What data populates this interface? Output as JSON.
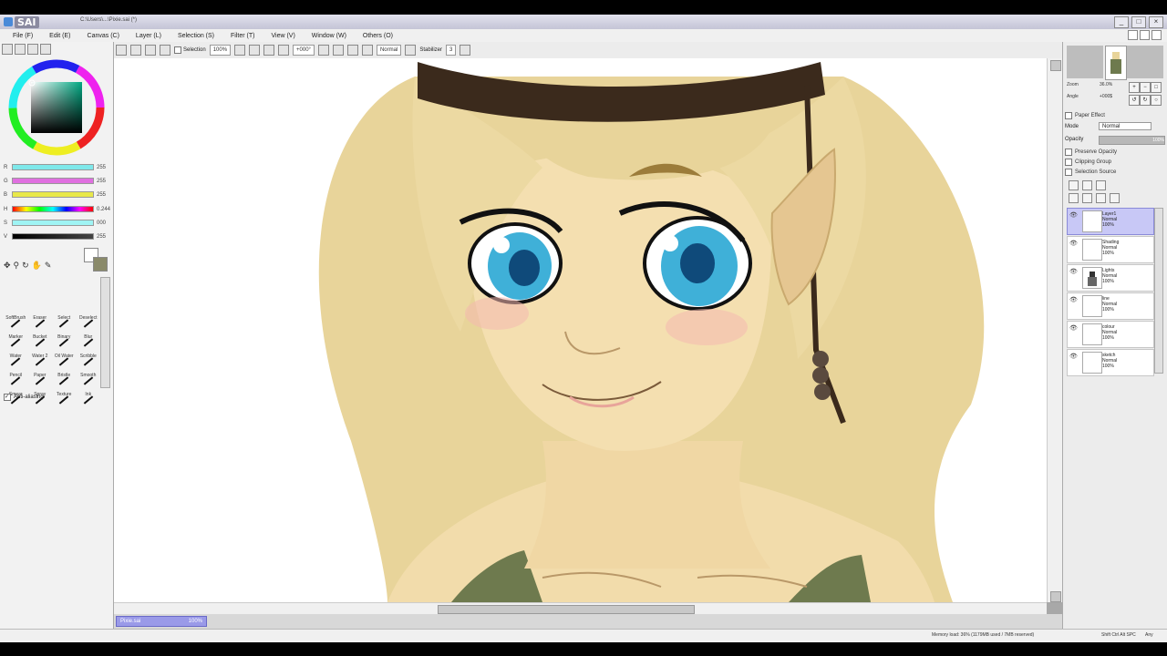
{
  "titlebar": {
    "app_name": "SAI",
    "path": "C:\\Users\\...\\Pixie.sai (*)"
  },
  "window_buttons": [
    "_",
    "□",
    "×"
  ],
  "menu": [
    "File (F)",
    "Edit (E)",
    "Canvas (C)",
    "Layer (L)",
    "Selection (S)",
    "Filter (T)",
    "View (V)",
    "Window (W)",
    "Others (O)"
  ],
  "toolbar": {
    "selection_label": "Selection",
    "zoom": "100%",
    "rotation": "+000°",
    "blend_mode": "Normal",
    "stabilizer_label": "Stabilizer",
    "stabilizer_value": "3"
  },
  "color_sliders": [
    {
      "label": "R",
      "value": "255",
      "color": "#7fe8ea"
    },
    {
      "label": "G",
      "value": "255",
      "color": "#e070e0"
    },
    {
      "label": "B",
      "value": "255",
      "color": "#e8e84a"
    },
    {
      "label": "H",
      "value": "0.244",
      "color": "rainbow"
    },
    {
      "label": "S",
      "value": "000",
      "color": "#9ff4f4"
    },
    {
      "label": "V",
      "value": "255",
      "color": "#1a1a1a"
    }
  ],
  "tools": [
    "SoftBrush",
    "Eraser",
    "Select",
    "Deselect",
    "Marker",
    "Bucket",
    "Binary",
    "Blur",
    "Water",
    "Water 2",
    "Oil Water",
    "Scribble",
    "Pencil",
    "Paper",
    "Bristle",
    "Smooth",
    "Smear",
    "Spray",
    "Texture",
    "Ink"
  ],
  "antialiasing_label": "Anti-aliasing",
  "navigator": {
    "zoom_label": "Zoom",
    "zoom_value": "36.0%",
    "angle_label": "Angle",
    "angle_value": "+000$"
  },
  "layer_panel": {
    "paper_effect": "Paper Effect",
    "mode_label": "Mode",
    "mode_value": "Normal",
    "opacity_label": "Opacity",
    "opacity_value": "100%",
    "preserve_opacity": "Preserve Opacity",
    "clipping_group": "Clipping Group",
    "selection_source": "Selection Source"
  },
  "layers": [
    {
      "name": "Layer1",
      "mode": "Normal",
      "opacity": "100%",
      "selected": true
    },
    {
      "name": "Shading",
      "mode": "Normal",
      "opacity": "100%",
      "selected": false
    },
    {
      "name": "Lights",
      "mode": "Normal",
      "opacity": "100%",
      "selected": false
    },
    {
      "name": "line",
      "mode": "Normal",
      "opacity": "100%",
      "selected": false
    },
    {
      "name": "colour",
      "mode": "Normal",
      "opacity": "100%",
      "selected": false
    },
    {
      "name": "sketch",
      "mode": "Normal",
      "opacity": "100%",
      "selected": false
    }
  ],
  "document_tab": {
    "name": "Pixie.sai",
    "zoom": "100%"
  },
  "status": {
    "memory": "Memory load: 36% (1179MB used / 7MB reserved)",
    "keys": "Shift Ctrl Alt SPC",
    "any": "Any"
  },
  "colors": {
    "accent": "#c8c8f6",
    "tab": "#9a9ae8",
    "hair": "#e8d49a",
    "skin": "#f2dcab",
    "eyes": "#3fb0d8"
  }
}
